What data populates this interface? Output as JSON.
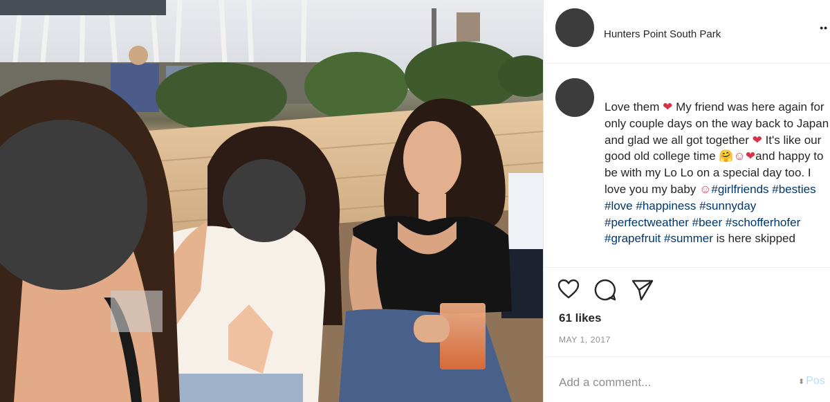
{
  "post": {
    "location": "Hunters Point South Park",
    "more_icon": "••",
    "caption": {
      "segments": [
        {
          "text": "Love them ",
          "type": "text"
        },
        {
          "text": "❤",
          "type": "emoji"
        },
        {
          "text": " My friend was here again for only couple days on the way back to Japan and glad we all got together ",
          "type": "text"
        },
        {
          "text": "❤",
          "type": "emoji"
        },
        {
          "text": " It's like our good old college time ",
          "type": "text"
        },
        {
          "text": "🤗☺❤",
          "type": "emoji"
        },
        {
          "text": "and happy to be with my Lo Lo on a special day too. I love you my baby ",
          "type": "text"
        },
        {
          "text": "☺",
          "type": "emoji"
        },
        {
          "text": "#girlfriends",
          "type": "tag"
        },
        {
          "text": " ",
          "type": "text"
        },
        {
          "text": "#besties",
          "type": "tag"
        },
        {
          "text": " ",
          "type": "text"
        },
        {
          "text": "#love",
          "type": "tag"
        },
        {
          "text": " ",
          "type": "text"
        },
        {
          "text": "#happiness",
          "type": "tag"
        },
        {
          "text": " ",
          "type": "text"
        },
        {
          "text": "#sunnyday",
          "type": "tag"
        },
        {
          "text": " ",
          "type": "text"
        },
        {
          "text": "#perfectweather",
          "type": "tag"
        },
        {
          "text": " ",
          "type": "text"
        },
        {
          "text": "#beer",
          "type": "tag"
        },
        {
          "text": " ",
          "type": "text"
        },
        {
          "text": "#schofferhofer",
          "type": "tag"
        },
        {
          "text": " ",
          "type": "text"
        },
        {
          "text": "#grapefruit",
          "type": "tag"
        },
        {
          "text": " ",
          "type": "text"
        },
        {
          "text": "#summer",
          "type": "tag"
        },
        {
          "text": " is here skipped",
          "type": "text"
        }
      ]
    },
    "icons": {
      "like": "heart-outline-icon",
      "comment": "speech-bubble-icon",
      "share": "paper-plane-icon"
    },
    "likes": "61 likes",
    "date": "MAY 1, 2017",
    "comment_placeholder": "Add a comment...",
    "post_label": "Pos",
    "colors": {
      "hashtag": "#00376b",
      "heart_emoji": "#d9304a",
      "avatar": "#3c3c3c",
      "post_button": "#b3dbff",
      "muted": "#8e8e8e"
    }
  }
}
